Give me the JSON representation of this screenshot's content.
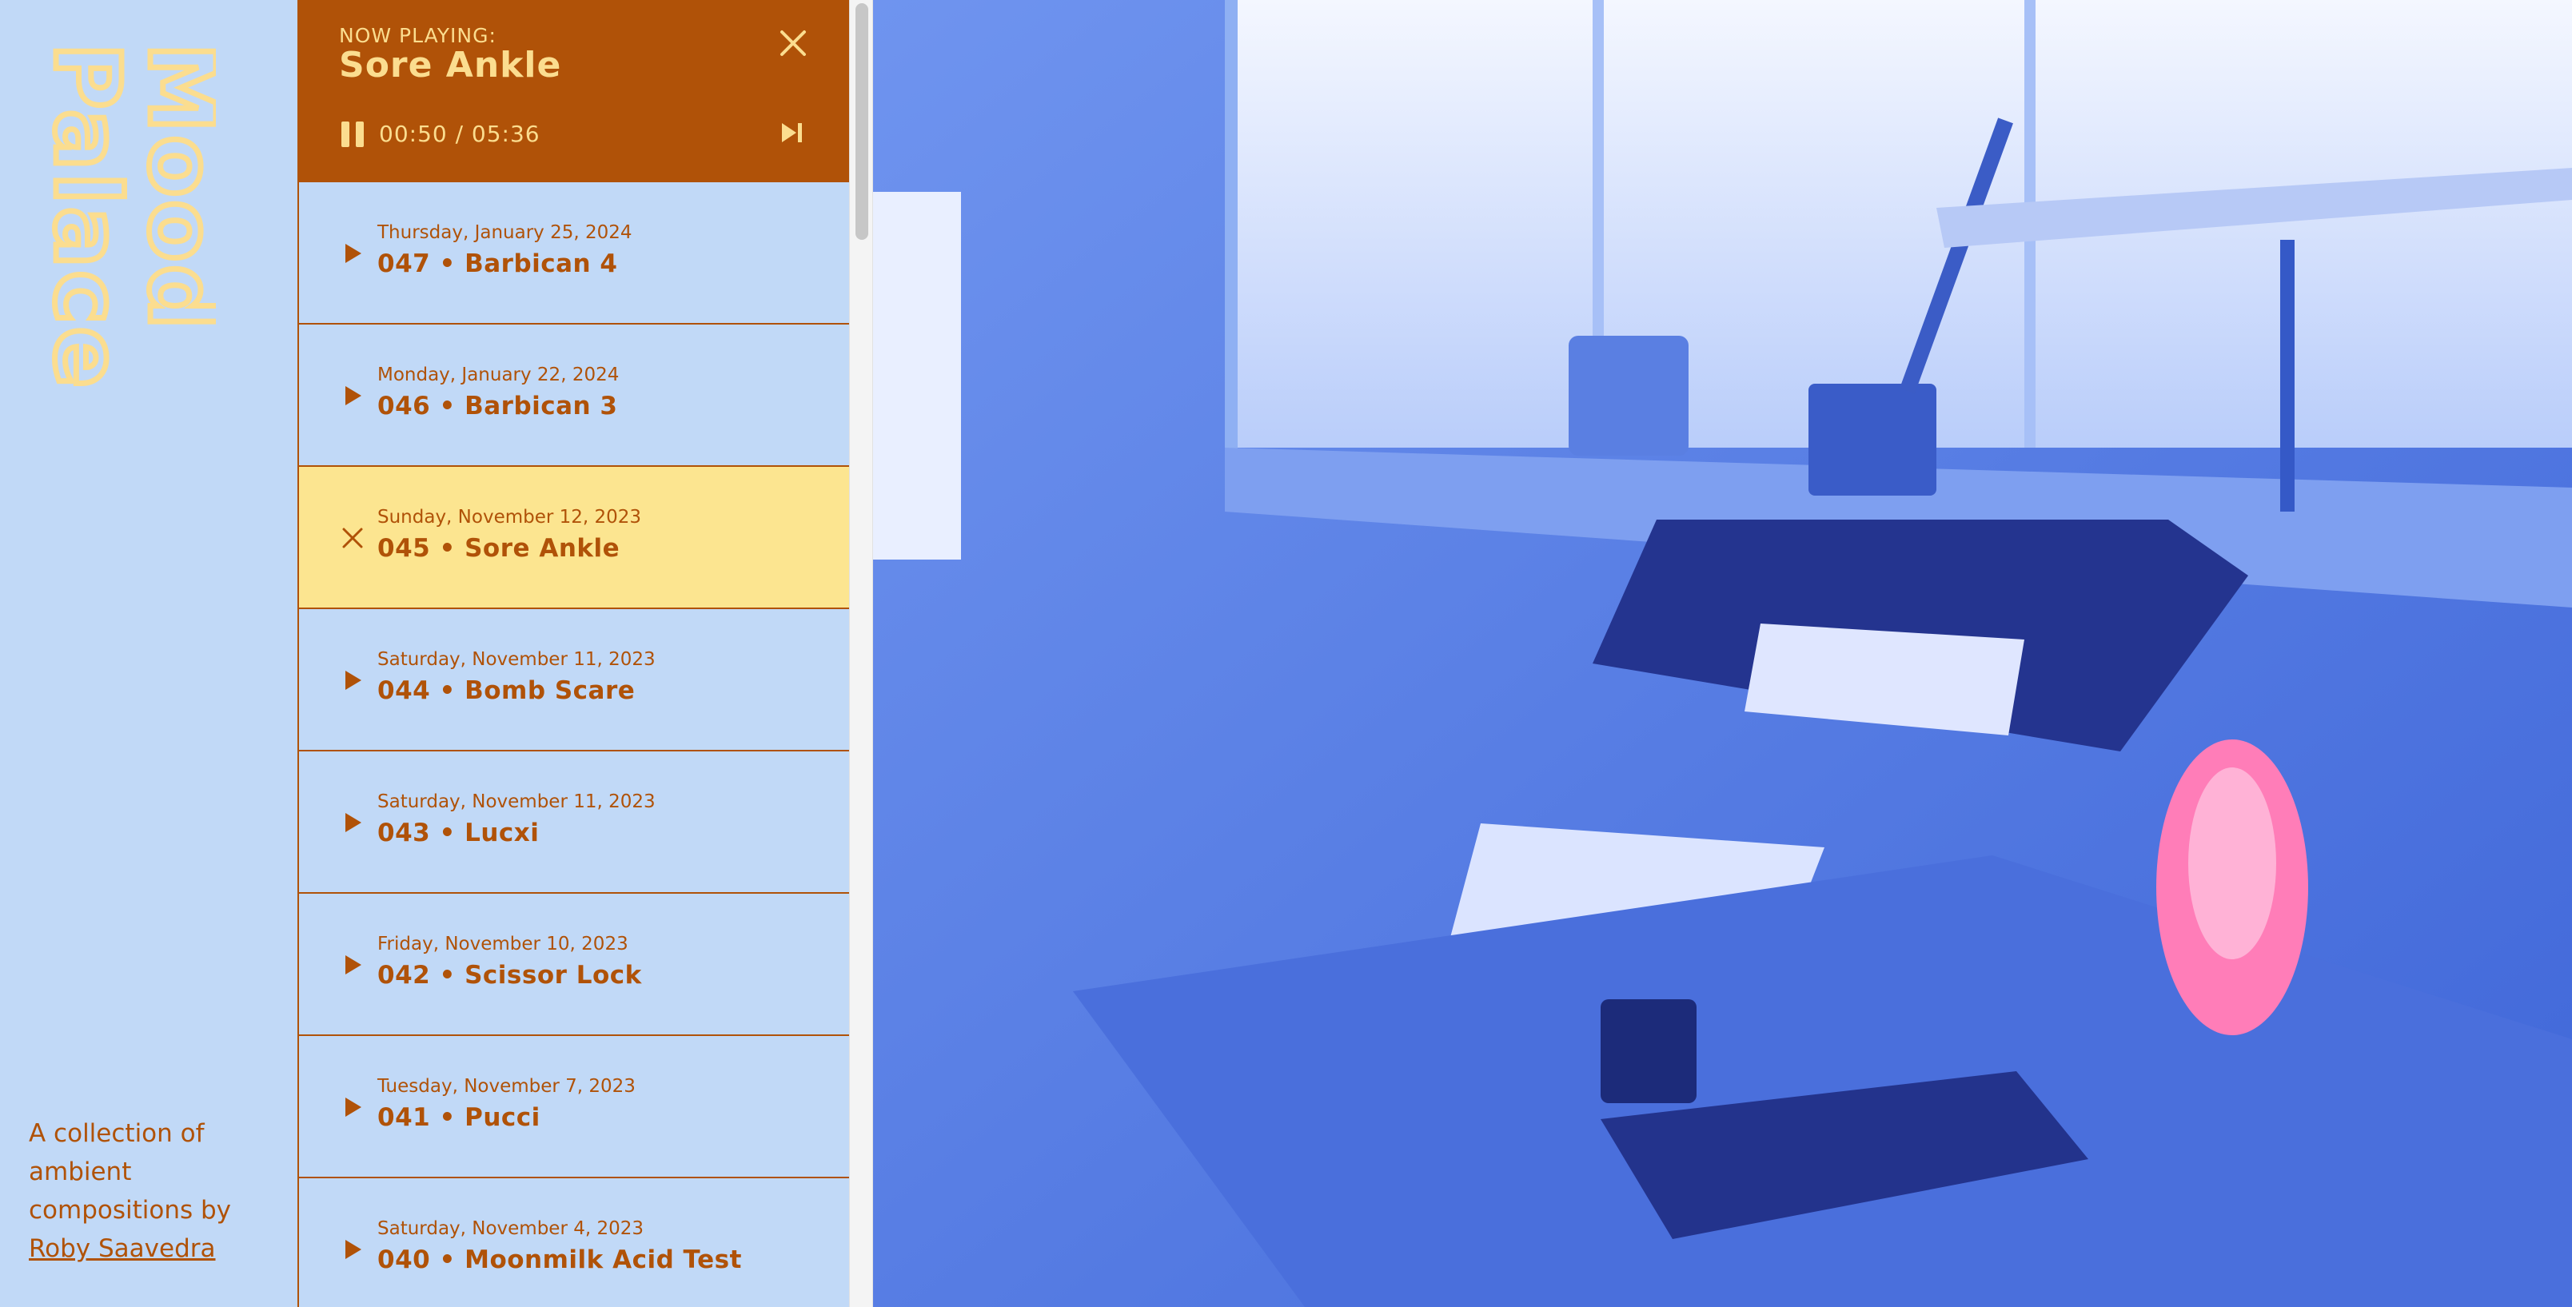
{
  "brand": {
    "logo_line1": "Mood",
    "logo_line2": "Palace",
    "tagline": "A collection of ambient compositions by",
    "author_link": "Roby Saavedra"
  },
  "player": {
    "label": "NOW PLAYING:",
    "title": "Sore Ankle",
    "time": "00:50 / 05:36",
    "icons": {
      "close": "close-icon",
      "pause": "pause-icon",
      "next": "skip-next-icon"
    }
  },
  "tracks": [
    {
      "date": "Thursday, January 25, 2024",
      "name": "047 • Barbican 4",
      "state": "play"
    },
    {
      "date": "Monday, January 22, 2024",
      "name": "046 • Barbican 3",
      "state": "play"
    },
    {
      "date": "Sunday, November 12, 2023",
      "name": "045 • Sore Ankle",
      "state": "active"
    },
    {
      "date": "Saturday, November 11, 2023",
      "name": "044 • Bomb Scare",
      "state": "play"
    },
    {
      "date": "Saturday, November 11, 2023",
      "name": "043 • Lucxi",
      "state": "play"
    },
    {
      "date": "Friday, November 10, 2023",
      "name": "042 • Scissor Lock",
      "state": "play"
    },
    {
      "date": "Tuesday, November 7, 2023",
      "name": "041 • Pucci",
      "state": "play"
    },
    {
      "date": "Saturday, November 4, 2023",
      "name": "040 • Moonmilk Acid Test",
      "state": "play"
    }
  ],
  "colors": {
    "background": "#c1d9f7",
    "accent": "#b05208",
    "cream": "#fbdd8f",
    "active_row": "#fce590",
    "photo_tint": "#4d7ae9"
  }
}
